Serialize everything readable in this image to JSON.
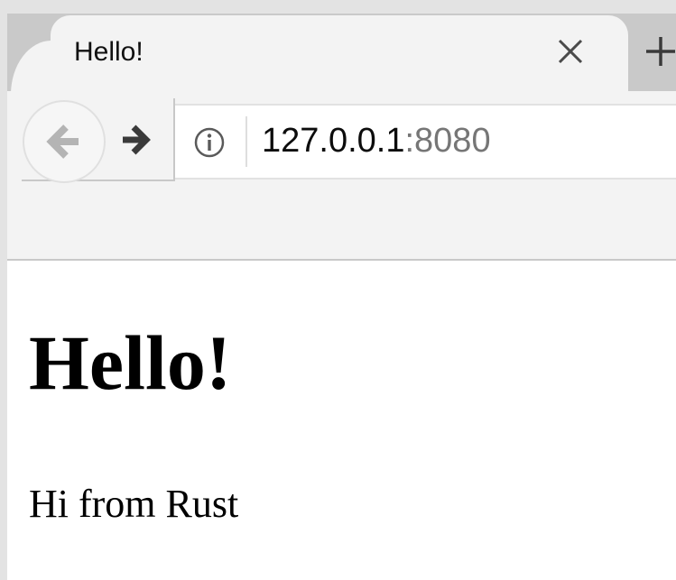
{
  "tab": {
    "title": "Hello!",
    "close_icon": "close-icon",
    "new_tab_icon": "plus-icon"
  },
  "toolbar": {
    "back_icon": "arrow-left-icon",
    "forward_icon": "arrow-right-icon",
    "site_info_icon": "info-icon"
  },
  "urlbar": {
    "host": "127.0.0.1",
    "port": ":8080"
  },
  "page": {
    "heading": "Hello!",
    "paragraph": "Hi from Rust"
  },
  "colors": {
    "tabstrip": "#c9c9c9",
    "toolbar": "#f3f3f3",
    "port_text": "#767676",
    "disabled_icon": "#b4b4b4",
    "icon": "#3a3a3a"
  }
}
